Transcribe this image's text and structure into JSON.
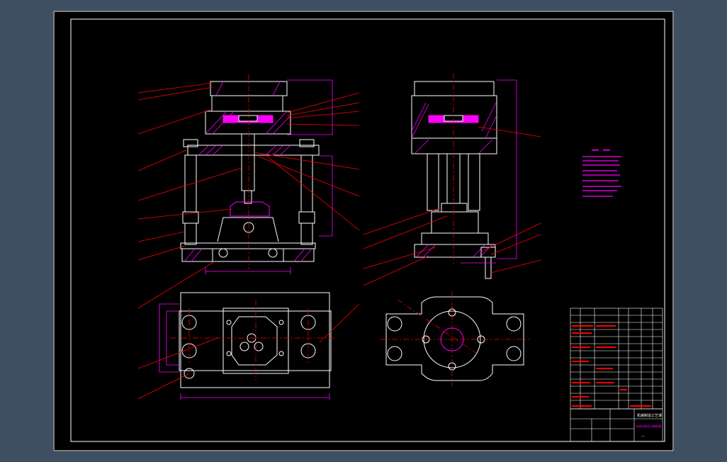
{
  "colors": {
    "background_outer": "#3f4f62",
    "canvas": "#000000",
    "lines": "#ffffff",
    "leaders": "#ff0000",
    "dimensions": "#ff00ff",
    "hatch": "#ff00ff",
    "notes": "#ff00ff"
  },
  "title_block": {
    "school": "机械制造工艺课",
    "drawing_title": "钻床夹具设计装配图",
    "sheet": "——"
  }
}
